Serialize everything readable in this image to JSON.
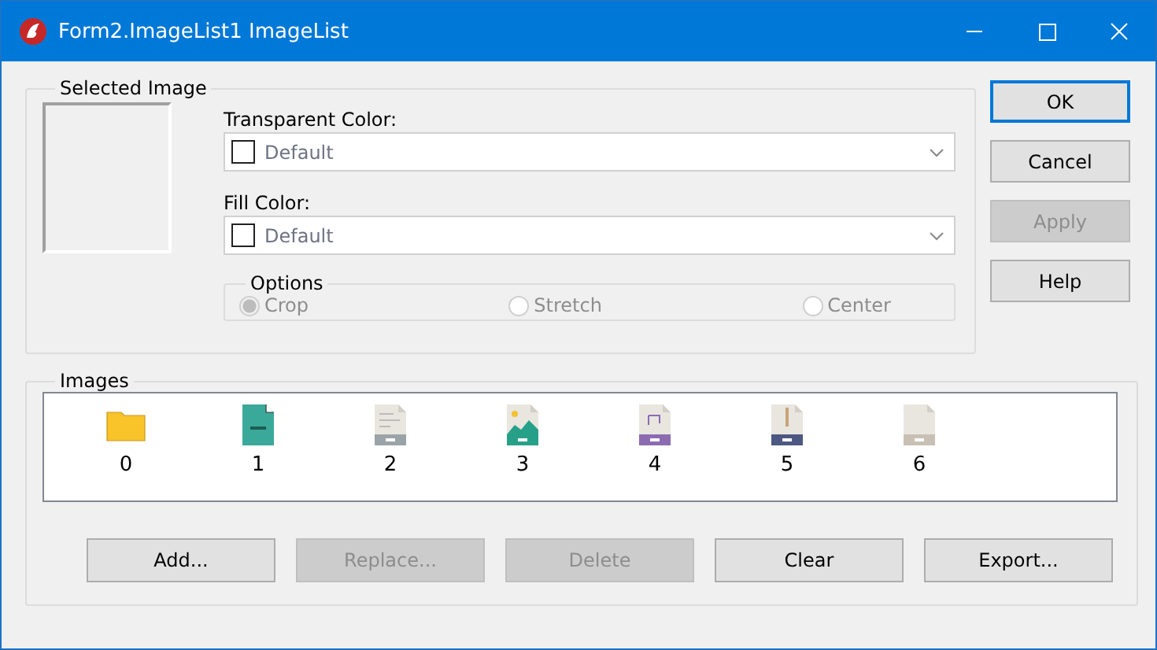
{
  "window": {
    "title": "Form2.ImageList1 ImageList"
  },
  "selected_image": {
    "title": "Selected Image"
  },
  "transparent_color": {
    "label": "Transparent Color:",
    "value": "Default"
  },
  "fill_color": {
    "label": "Fill Color:",
    "value": "Default"
  },
  "options": {
    "title": "Options",
    "disabled": true,
    "choices": [
      {
        "label": "Crop",
        "selected": true
      },
      {
        "label": "Stretch",
        "selected": false
      },
      {
        "label": "Center",
        "selected": false
      }
    ]
  },
  "side_buttons": [
    {
      "label": "OK",
      "default": true,
      "disabled": false
    },
    {
      "label": "Cancel",
      "default": false,
      "disabled": false
    },
    {
      "label": "Apply",
      "default": false,
      "disabled": true
    },
    {
      "label": "Help",
      "default": false,
      "disabled": false
    }
  ],
  "images": {
    "title": "Images",
    "items": [
      {
        "label": "0",
        "kind": "folder"
      },
      {
        "label": "1",
        "kind": "document"
      },
      {
        "label": "2",
        "kind": "text"
      },
      {
        "label": "3",
        "kind": "image"
      },
      {
        "label": "4",
        "kind": "audio"
      },
      {
        "label": "5",
        "kind": "archive"
      },
      {
        "label": "6",
        "kind": "blank"
      }
    ]
  },
  "bottom_buttons": [
    {
      "label": "Add...",
      "disabled": false
    },
    {
      "label": "Replace...",
      "disabled": true
    },
    {
      "label": "Delete",
      "disabled": true
    },
    {
      "label": "Clear",
      "disabled": false
    },
    {
      "label": "Export...",
      "disabled": false
    }
  ]
}
